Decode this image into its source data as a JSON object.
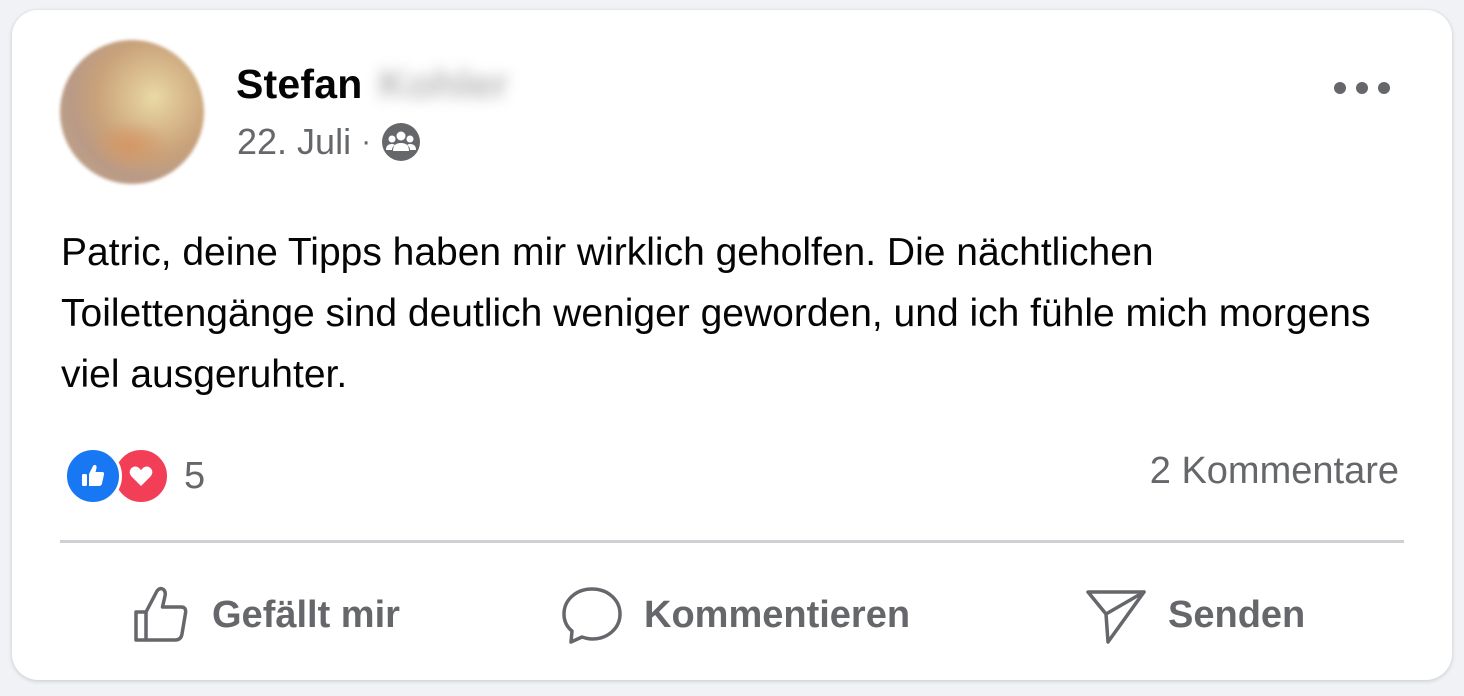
{
  "post": {
    "author_first_name": "Stefan",
    "author_last_name": "Kohler",
    "date": "22. Juli",
    "separator": "·",
    "audience_icon": "group-icon",
    "more_icon": "more-options-icon",
    "text": "Patric, deine Tipps haben mir wirklich geholfen. Die nächtlichen Toilettengänge sind deutlich weniger geworden, und ich fühle mich morgens viel ausgeruhter."
  },
  "stats": {
    "reaction_icons": [
      "like-reaction-icon",
      "love-reaction-icon"
    ],
    "reaction_count": "5",
    "comments": "2 Kommentare"
  },
  "actions": {
    "like_label": "Gefällt mir",
    "comment_label": "Kommentieren",
    "send_label": "Senden"
  },
  "colors": {
    "like_blue": "#1877f2",
    "love_red": "#f33e58",
    "secondary_text": "#65676b",
    "primary_text": "#050505",
    "divider": "#ced0d4"
  }
}
